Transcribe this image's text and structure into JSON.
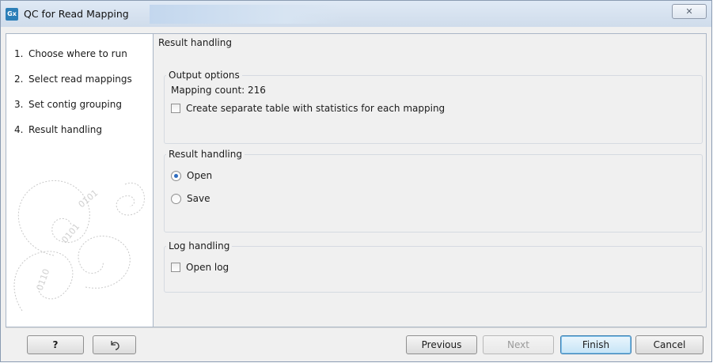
{
  "window": {
    "title": "QC for Read Mapping",
    "app_icon_text": "Gx",
    "close_label": "✕"
  },
  "steps": [
    {
      "num": "1.",
      "label": "Choose where to run"
    },
    {
      "num": "2.",
      "label": "Select read mappings"
    },
    {
      "num": "3.",
      "label": "Set contig grouping"
    },
    {
      "num": "4.",
      "label": "Result handling"
    }
  ],
  "panel": {
    "title": "Result handling",
    "output_options": {
      "label": "Output options",
      "mapping_count": "Mapping count: 216",
      "separate_table_label": "Create separate table with statistics for each mapping",
      "separate_table_checked": false
    },
    "result_handling": {
      "label": "Result handling",
      "options": [
        {
          "label": "Open",
          "selected": true
        },
        {
          "label": "Save",
          "selected": false
        }
      ]
    },
    "log_handling": {
      "label": "Log handling",
      "open_log_label": "Open log",
      "open_log_checked": false
    }
  },
  "buttons": {
    "help": "?",
    "previous": "Previous",
    "next": "Next",
    "finish": "Finish",
    "cancel": "Cancel"
  }
}
